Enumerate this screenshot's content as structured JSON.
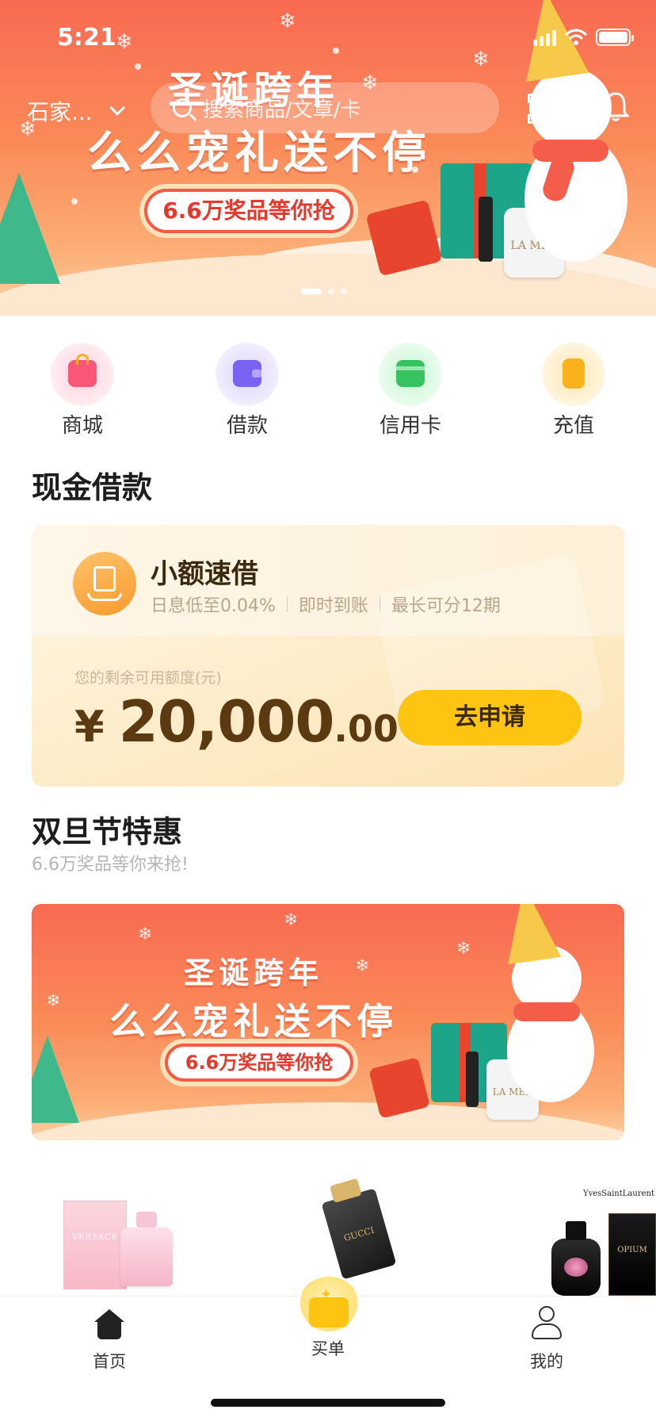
{
  "status_bar": {
    "time": "5:21"
  },
  "header": {
    "city": "石家...",
    "search_placeholder": "搜索商品/文章/卡"
  },
  "hero_banner": {
    "line1": "圣诞跨年",
    "line2": "么么宠礼送不停",
    "pill": "6.6万奖品等你抢",
    "product_tag": "LA MER",
    "page_count": 3,
    "active_page": 1
  },
  "quick_entries": [
    {
      "label": "商城",
      "icon": "shopping-bag-icon",
      "color": "#f9577a"
    },
    {
      "label": "借款",
      "icon": "wallet-icon",
      "color": "#7a63f2"
    },
    {
      "label": "信用卡",
      "icon": "credit-card-icon",
      "color": "#35c25f"
    },
    {
      "label": "充值",
      "icon": "recharge-phone-icon",
      "color": "#f9b21c"
    }
  ],
  "cash_loan": {
    "section_title": "现金借款",
    "product_name": "小额速借",
    "features": [
      "日息低至0.04%",
      "即时到账",
      "最长可分12期"
    ],
    "quota_label": "您的剩余可用额度(元)",
    "currency": "¥",
    "amount_integer": "20,000",
    "amount_decimal": ".00",
    "apply_label": "去申请"
  },
  "holiday_deals": {
    "section_title": "双旦节特惠",
    "subtitle": "6.6万奖品等你来抢!",
    "banner_line1": "圣诞跨年",
    "banner_line2": "么么宠礼送不停",
    "banner_pill": "6.6万奖品等你抢",
    "banner_product_tag": "LA MER"
  },
  "products": [
    {
      "brand": "VERSACE",
      "name": "VERSACE"
    },
    {
      "brand": "GUCCI",
      "name": "GUCCI"
    },
    {
      "brand": "YvesSaintLaurent",
      "name": "OPIUM"
    }
  ],
  "tab_bar": {
    "items": [
      {
        "label": "首页",
        "icon": "home-icon",
        "active": true
      },
      {
        "label": "买单",
        "icon": "pay-wallet-icon",
        "active": false
      },
      {
        "label": "我的",
        "icon": "profile-icon",
        "active": false
      }
    ]
  },
  "colors": {
    "banner_red": "#f96a52",
    "accent_yellow": "#fdc511",
    "amount_brown": "#5b3a12"
  }
}
